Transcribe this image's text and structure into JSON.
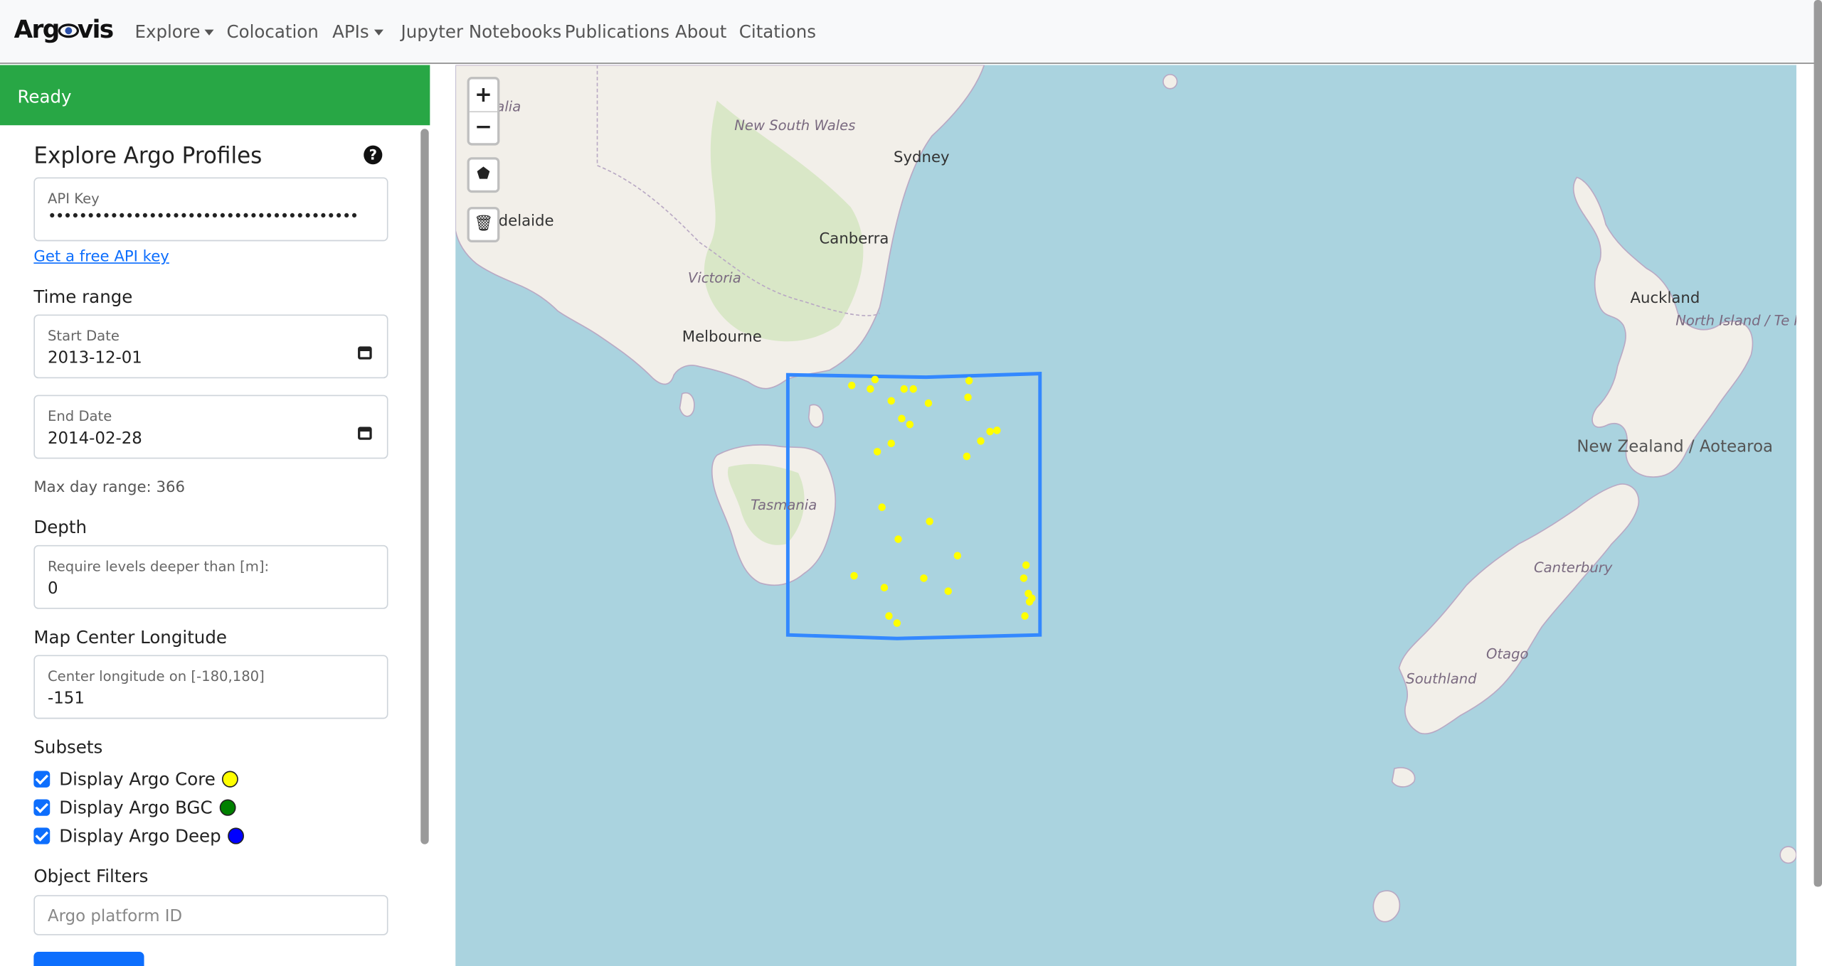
{
  "nav": {
    "brand": "Argovis",
    "items": [
      {
        "label": "Explore",
        "dropdown": true
      },
      {
        "label": "Colocation",
        "dropdown": false
      },
      {
        "label": "APIs",
        "dropdown": true
      },
      {
        "label": "Jupyter Notebooks",
        "dropdown": false
      },
      {
        "label": "Publications",
        "dropdown": false
      },
      {
        "label": "About",
        "dropdown": false
      },
      {
        "label": "Citations",
        "dropdown": false
      }
    ]
  },
  "status": {
    "text": "Ready",
    "color": "#28a745"
  },
  "panel": {
    "title": "Explore Argo Profiles",
    "api_key": {
      "label": "API Key",
      "value": "••••••••••••••••••••••••••••••••••••••••"
    },
    "api_link": "Get a free API key",
    "time_range": {
      "label": "Time range",
      "start": {
        "label": "Start Date",
        "value": "2013-12-01"
      },
      "end": {
        "label": "End Date",
        "value": "2014-02-28"
      },
      "note": "Max day range: 366"
    },
    "depth": {
      "label": "Depth",
      "field_label": "Require levels deeper than [m]:",
      "value": "0"
    },
    "center": {
      "label": "Map Center Longitude",
      "field_label": "Center longitude on [-180,180]",
      "value": "-151"
    },
    "subsets": {
      "label": "Subsets",
      "items": [
        {
          "label": "Display Argo Core",
          "checked": true,
          "color": "#ffff00"
        },
        {
          "label": "Display Argo BGC",
          "checked": true,
          "color": "#008000"
        },
        {
          "label": "Display Argo Deep",
          "checked": true,
          "color": "#0000ff"
        }
      ]
    },
    "object_filters": {
      "label": "Object Filters",
      "placeholder": "Argo platform ID"
    }
  },
  "map": {
    "controls": {
      "zoom_in": "+",
      "zoom_out": "−",
      "draw_icon": "pentagon-icon",
      "delete_icon": "trash-icon"
    },
    "labels": {
      "new_south_wales": "New South Wales",
      "sydney": "Sydney",
      "canberra": "Canberra",
      "adelaide": "delaide",
      "australia_fragment": "ralia",
      "victoria": "Victoria",
      "melbourne": "Melbourne",
      "tasmania": "Tasmania",
      "auckland": "Auckland",
      "north_island": "North Island / Te Ika-a-Māui",
      "new_zealand": "New Zealand / Aotearoa",
      "canterbury": "Canterbury",
      "otago": "Otago",
      "southland": "Southland"
    },
    "water_color": "#aad3df",
    "land_color": "#f2efe9",
    "selection_color": "#3388ff",
    "profile_color": "#ffff00",
    "profile_count": 33
  }
}
